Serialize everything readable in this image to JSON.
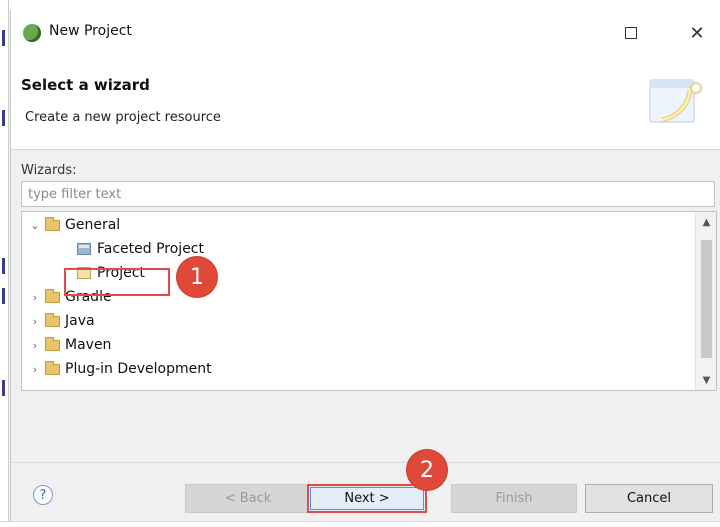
{
  "window": {
    "title": "New Project",
    "controls": {
      "maximize_icon": "maximize-icon",
      "close_glyph": "✕"
    }
  },
  "header": {
    "title": "Select a wizard",
    "description": "Create a new project resource"
  },
  "wizards": {
    "label": "Wizards:",
    "filter_placeholder": "type filter text",
    "tree": [
      {
        "label": "General",
        "type": "folder",
        "expanded": true,
        "level": 0
      },
      {
        "label": "Faceted Project",
        "type": "project",
        "level": 1
      },
      {
        "label": "Project",
        "type": "project",
        "level": 1,
        "selected": true
      },
      {
        "label": "Gradle",
        "type": "folder",
        "expanded": false,
        "level": 0
      },
      {
        "label": "Java",
        "type": "folder",
        "expanded": false,
        "level": 0
      },
      {
        "label": "Maven",
        "type": "folder",
        "expanded": false,
        "level": 0
      },
      {
        "label": "Plug-in Development",
        "type": "folder",
        "expanded": false,
        "level": 0
      }
    ]
  },
  "annotations": {
    "step1": "1",
    "step2": "2",
    "color": "#e0493a"
  },
  "footer": {
    "help": "?",
    "back": "< Back",
    "next": "Next >",
    "finish": "Finish",
    "cancel": "Cancel"
  }
}
